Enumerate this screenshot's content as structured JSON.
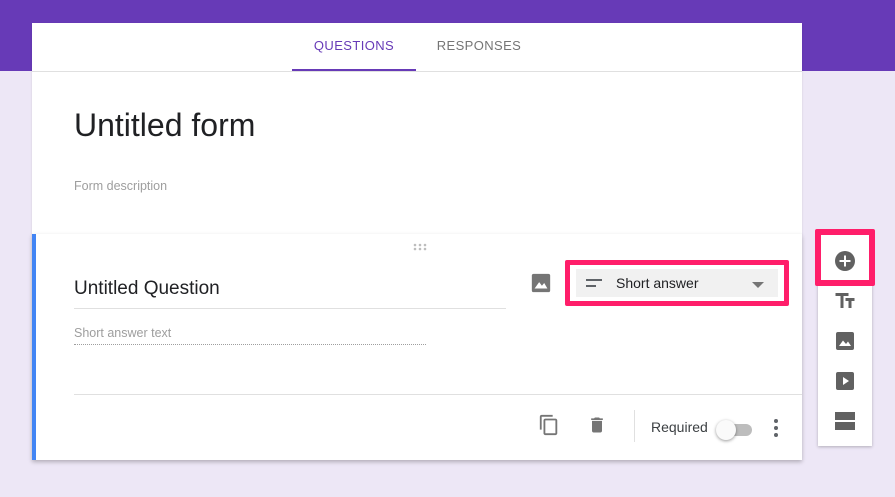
{
  "colors": {
    "brand_purple": "#673ab7",
    "page_background": "#ede7f6",
    "accent_blue": "#4285f4",
    "highlight_pink": "#ff1e6a"
  },
  "tabs": [
    {
      "label": "QUESTIONS",
      "active": true
    },
    {
      "label": "RESPONSES",
      "active": false
    }
  ],
  "form": {
    "title": "Untitled form",
    "description_placeholder": "Form description"
  },
  "question": {
    "title": "Untitled Question",
    "answer_placeholder": "Short answer text",
    "type_label": "Short answer",
    "required_label": "Required",
    "required_on": false,
    "icons": [
      "drag-handle-icon",
      "image-icon",
      "short-answer-icon",
      "dropdown-arrow-icon",
      "duplicate-icon",
      "trash-icon",
      "more-vert-icon"
    ]
  },
  "toolbar": {
    "items": [
      {
        "name": "add-question",
        "icon": "add-circle-icon",
        "highlighted": true
      },
      {
        "name": "add-title",
        "icon": "title-text-icon"
      },
      {
        "name": "add-image",
        "icon": "image-icon"
      },
      {
        "name": "add-video",
        "icon": "video-play-icon"
      },
      {
        "name": "add-section",
        "icon": "section-icon"
      }
    ]
  }
}
